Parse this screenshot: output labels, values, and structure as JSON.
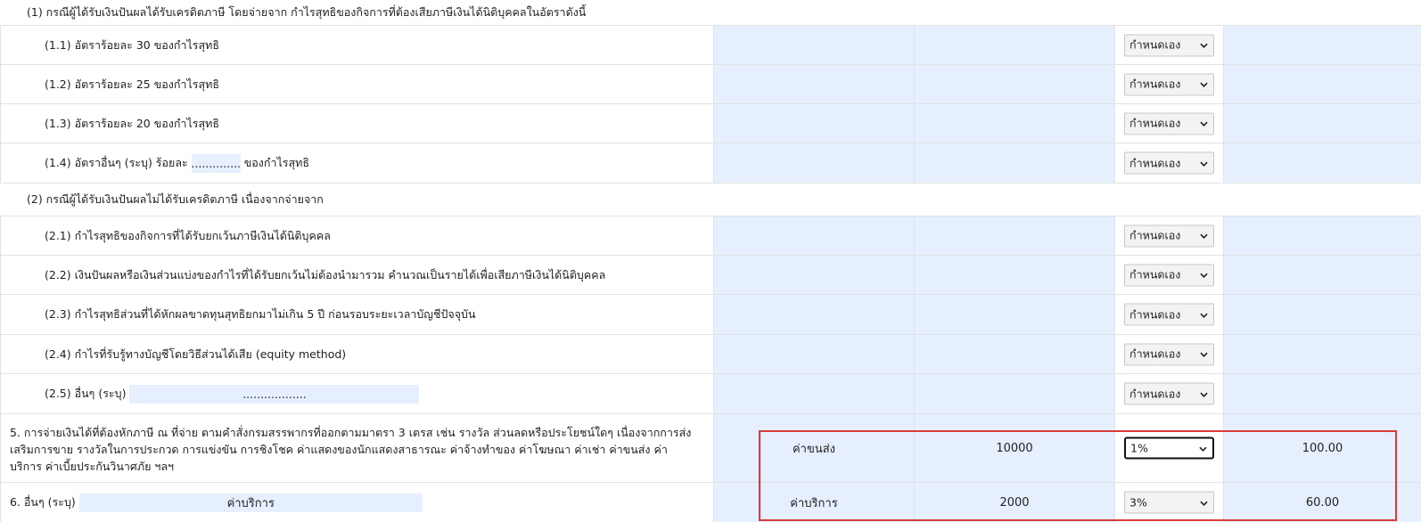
{
  "section1": {
    "header": "(1) กรณีผู้ได้รับเงินปันผลได้รับเครดิตภาษี โดยจ่ายจาก กำไรสุทธิของกิจการที่ต้องเสียภาษีเงินได้นิติบุคคลในอัตราดังนี้",
    "items": [
      {
        "label": "(1.1) อัตราร้อยละ 30 ของกำไรสุทธิ"
      },
      {
        "label": "(1.2) อัตราร้อยละ 25 ของกำไรสุทธิ"
      },
      {
        "label": "(1.3) อัตราร้อยละ 20 ของกำไรสุทธิ"
      },
      {
        "label_prefix": "(1.4) อัตราอื่นๆ (ระบุ) ร้อยละ",
        "input_value": "..............",
        "label_suffix": "ของกำไรสุทธิ"
      }
    ]
  },
  "section2": {
    "header": "(2) กรณีผู้ได้รับเงินปันผลไม่ได้รับเครดิตภาษี เนื่องจากจ่ายจาก",
    "items": [
      {
        "label": "(2.1) กำไรสุทธิของกิจการที่ได้รับยกเว้นภาษีเงินได้นิติบุคคล"
      },
      {
        "label": "(2.2) เงินปันผลหรือเงินส่วนแบ่งของกำไรที่ได้รับยกเว้นไม่ต้องนำมารวม คำนวณเป็นรายได้เพื่อเสียภาษีเงินได้นิติบุคคล"
      },
      {
        "label": "(2.3) กำไรสุทธิส่วนที่ได้หักผลขาดทุนสุทธิยกมาไม่เกิน 5 ปี ก่อนรอบระยะเวลาบัญชีปัจจุบัน"
      },
      {
        "label": "(2.4) กำไรที่รับรู้ทางบัญชีโดยวิธีส่วนได้เสีย (equity method)"
      },
      {
        "label_prefix": "(2.5) อื่นๆ (ระบุ)",
        "input_value": ".................."
      }
    ]
  },
  "select_default": "กำหนดเอง",
  "row5": {
    "description": "5. การจ่ายเงินได้ที่ต้องหักภาษี ณ ที่จ่าย ตามคำสั่งกรมสรรพากรที่ออกตามมาตรา 3 เตรส เช่น รางวัล ส่วนลดหรือประโยชน์ใดๆ เนื่องจากการส่งเสริมการขาย รางวัลในการประกวด การแข่งขัน การชิงโชค ค่าแสดงของนักแสดงสาธารณะ ค่าจ้างทำของ ค่าโฆษณา ค่าเช่า ค่าขนส่ง ค่าบริการ ค่าเบี้ยประกันวินาศภัย ฯลฯ",
    "type": "ค่าขนส่ง",
    "amount": "10000",
    "rate": "1%",
    "tax": "100.00"
  },
  "row6": {
    "label": "6. อื่นๆ (ระบุ)",
    "input_value": "ค่าบริการ",
    "type": "ค่าบริการ",
    "amount": "2000",
    "rate": "3%",
    "tax": "60.00"
  },
  "colors": {
    "cell_bg": "#e6effd",
    "highlight": "#d93a3a"
  },
  "icons": {
    "select_arrow": "chevron-down-icon"
  }
}
